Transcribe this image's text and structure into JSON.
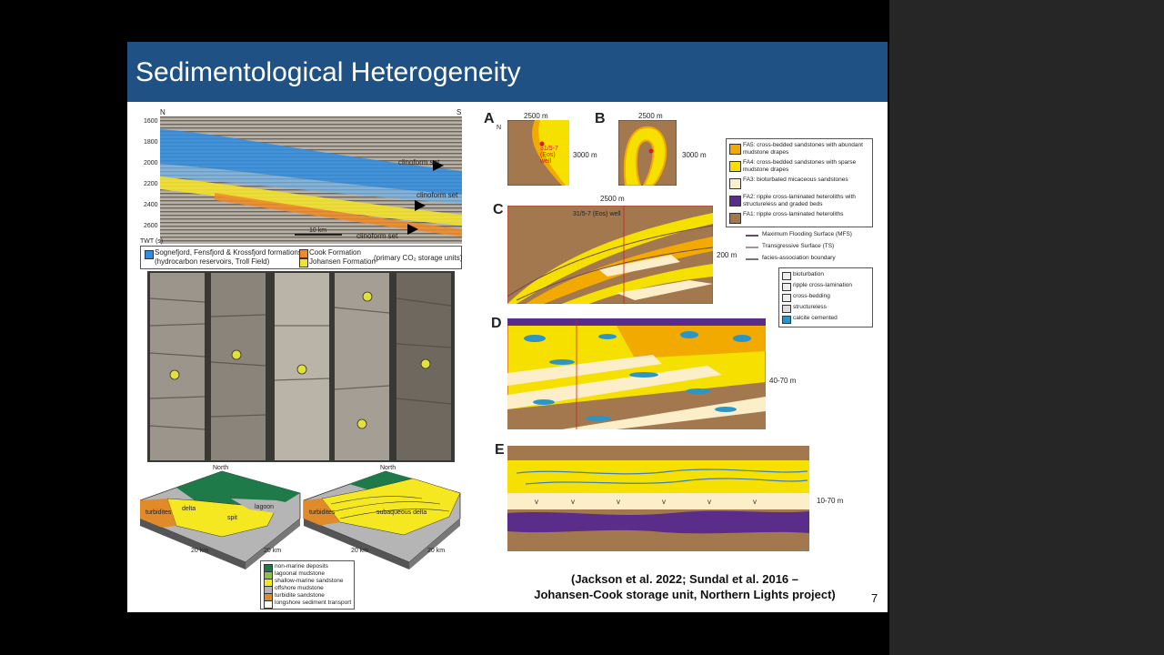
{
  "slide": {
    "title": "Sedimentological Heterogeneity",
    "page_number": "7",
    "citation_line1": "(Jackson et al. 2022; Sundal et al. 2016 –",
    "citation_line2": "Johansen-Cook storage unit, Northern Lights project)"
  },
  "seismic": {
    "north": "N",
    "south": "S",
    "axis_label": "TWT (s)",
    "depth_ticks": [
      "1600",
      "1800",
      "2000",
      "2200",
      "2400",
      "2600"
    ],
    "clinoform_label": "clinoform set",
    "scale_bar": "10 km",
    "legend": {
      "sognefjord_line1": "Sognefjord, Fensfjord & Krossfjord formations",
      "sognefjord_line2": "(hydrocarbon reservoirs, Troll Field)",
      "cook": "Cook Formation",
      "johansen": "Johansen Formation",
      "storage_note": "(primary CO₂ storage units)"
    },
    "colors": {
      "sognefjord": "#2f8de0",
      "cook": "#f08a26",
      "johansen": "#f2e230"
    }
  },
  "block_diagrams": {
    "north": "North",
    "scale": "20 km",
    "labels": [
      "turbidites",
      "delta",
      "lagoon",
      "spit",
      "subaqueous delta"
    ],
    "legend": [
      {
        "label": "non-marine deposits",
        "color": "#1f7a4a"
      },
      {
        "label": "lagoonal mudstone",
        "color": "#8fbf45"
      },
      {
        "label": "shallow-marine sandstone",
        "color": "#f5e820"
      },
      {
        "label": "offshore mudstone",
        "color": "#b5b5b5"
      },
      {
        "label": "turbidite sandstone",
        "color": "#e08a2a"
      },
      {
        "label": "longshore sediment transport",
        "color": "#ffffff"
      }
    ]
  },
  "facies_panel": {
    "panel_labels": [
      "A",
      "B",
      "C",
      "D",
      "E"
    ],
    "dims": {
      "a_width": "2500 m",
      "a_height": "3000 m",
      "b_width": "2500 m",
      "b_height": "3000 m",
      "c_width": "2500 m",
      "c_height": "200 m",
      "d_height": "40-70 m",
      "e_height": "10-70 m"
    },
    "well_label_a": "31/5-7 (Eos) well",
    "well_label_c": "31/5-7 (Eos) well",
    "north": "N",
    "facies_legend": [
      {
        "label": "FA5: cross-bedded sandstones with abundant mudstone drapes",
        "color": "#f2a900"
      },
      {
        "label": "FA4: cross-bedded sandstones with sparse mudstone drapes",
        "color": "#f5e000"
      },
      {
        "label": "FA3: bioturbated micaceous sandstones",
        "color": "#fbeec8"
      },
      {
        "label": "FA2: ripple cross-laminated heteroliths with structureless and graded beds",
        "color": "#5a2d8a"
      },
      {
        "label": "FA1: ripple cross-laminated heteroliths",
        "color": "#a3784f"
      }
    ],
    "surface_legend": [
      "Maximum Flooding Surface (MFS)",
      "Transgressive Surface (TS)",
      "facies-association boundary"
    ],
    "symbol_legend": [
      "bioturbation",
      "ripple cross-lamination",
      "cross-bedding",
      "structureless",
      "calcite cemented"
    ]
  }
}
